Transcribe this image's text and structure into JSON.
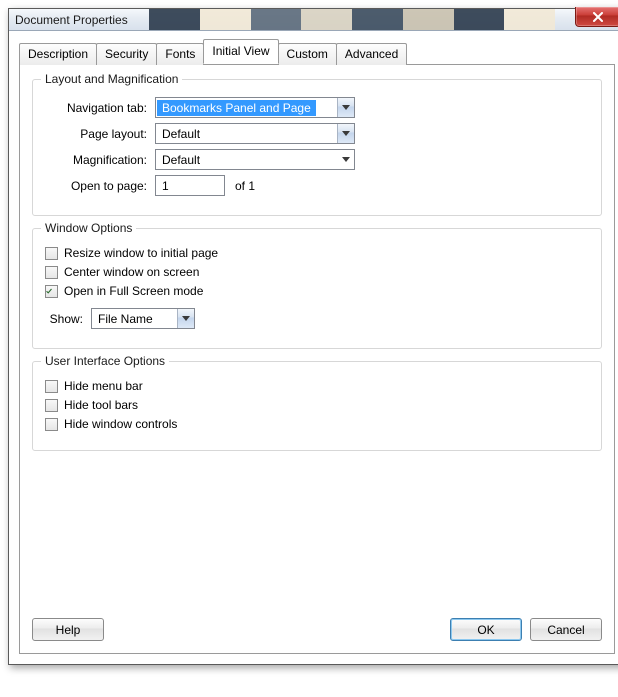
{
  "window": {
    "title": "Document Properties"
  },
  "tabs": [
    {
      "label": "Description"
    },
    {
      "label": "Security"
    },
    {
      "label": "Fonts"
    },
    {
      "label": "Initial View"
    },
    {
      "label": "Custom"
    },
    {
      "label": "Advanced"
    }
  ],
  "active_tab_index": 3,
  "layout_group": {
    "legend": "Layout and Magnification",
    "nav_tab_label": "Navigation tab:",
    "nav_tab_value": "Bookmarks Panel and Page",
    "page_layout_label": "Page layout:",
    "page_layout_value": "Default",
    "magnification_label": "Magnification:",
    "magnification_value": "Default",
    "open_to_page_label": "Open to page:",
    "open_to_page_value": "1",
    "open_to_page_suffix": "of 1"
  },
  "window_group": {
    "legend": "Window Options",
    "resize_label": "Resize window to initial page",
    "resize_checked": false,
    "center_label": "Center window on screen",
    "center_checked": false,
    "fullscreen_label": "Open in Full Screen mode",
    "fullscreen_checked": true,
    "show_label": "Show:",
    "show_value": "File Name"
  },
  "ui_group": {
    "legend": "User Interface Options",
    "hide_menu_label": "Hide menu bar",
    "hide_menu_checked": false,
    "hide_tool_label": "Hide tool bars",
    "hide_tool_checked": false,
    "hide_win_label": "Hide window controls",
    "hide_win_checked": false
  },
  "buttons": {
    "help": "Help",
    "ok": "OK",
    "cancel": "Cancel"
  }
}
